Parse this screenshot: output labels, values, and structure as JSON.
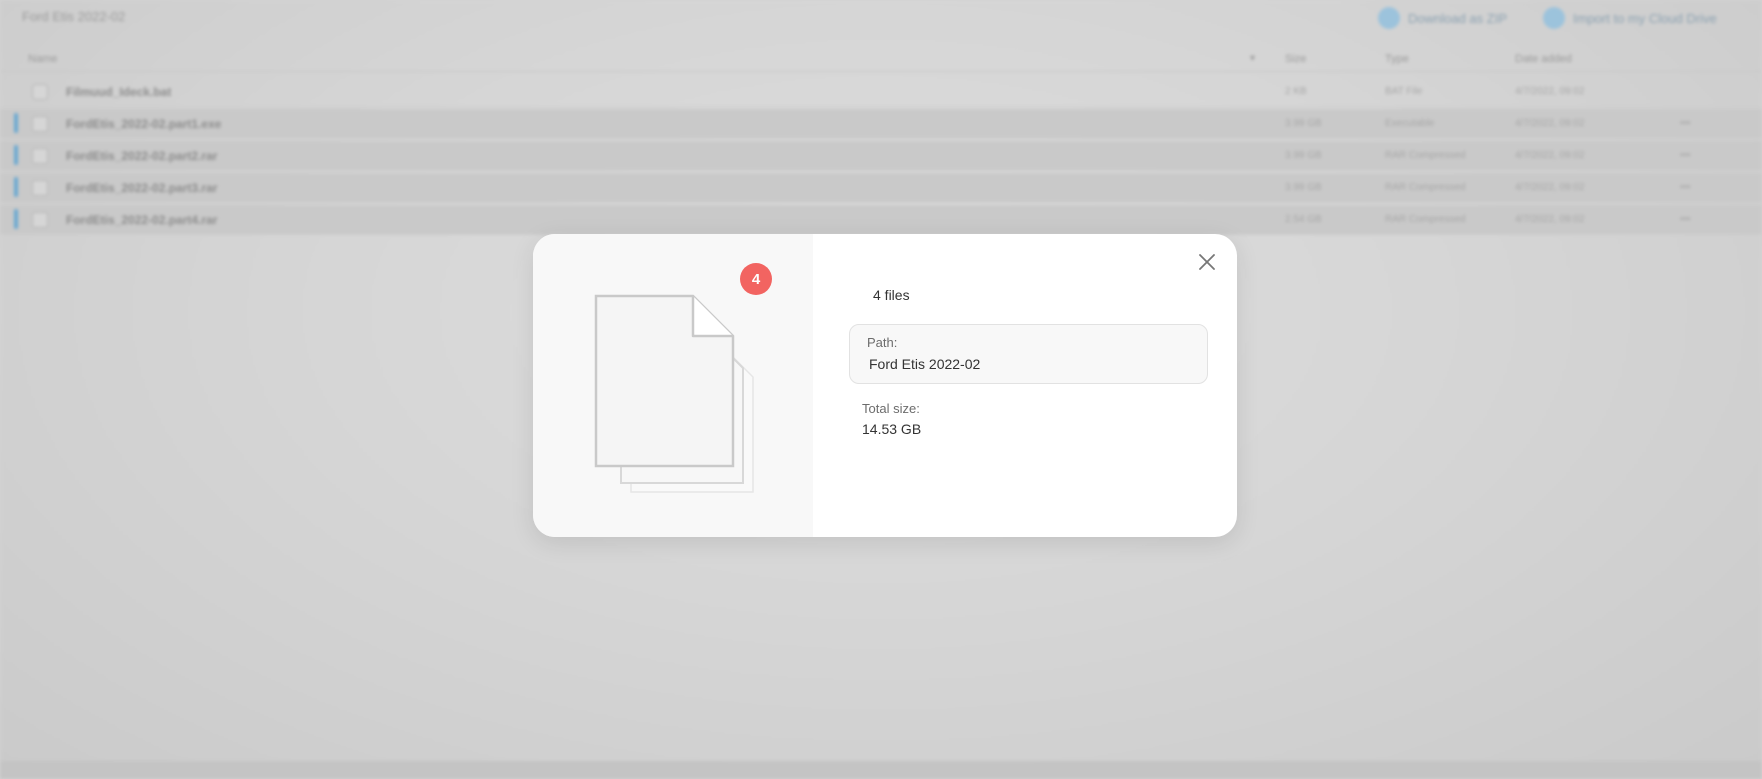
{
  "background": {
    "title": "Ford Etis 2022-02",
    "actions": [
      {
        "label": "Download as ZIP",
        "icon": "download-icon"
      },
      {
        "label": "Import to my Cloud Drive",
        "icon": "cloud-import-icon"
      }
    ],
    "columns": [
      "Name",
      "Size",
      "Type",
      "Date added"
    ],
    "rows": [
      {
        "name": "Filmuud_Ideck.bat",
        "size": "2 KB",
        "type": "BAT File",
        "date": "4/7/2022, 09:02"
      },
      {
        "name": "FordEtis_2022-02.part1.exe",
        "size": "3.99 GB",
        "type": "Executable",
        "date": "4/7/2022, 09:02"
      },
      {
        "name": "FordEtis_2022-02.part2.rar",
        "size": "3.99 GB",
        "type": "RAR Compressed",
        "date": "4/7/2022, 09:02"
      },
      {
        "name": "FordEtis_2022-02.part3.rar",
        "size": "3.99 GB",
        "type": "RAR Compressed",
        "date": "4/7/2022, 09:02"
      },
      {
        "name": "FordEtis_2022-02.part4.rar",
        "size": "2.54 GB",
        "type": "RAR Compressed",
        "date": "4/7/2022, 09:02"
      }
    ]
  },
  "modal": {
    "badge_count": "4",
    "files_count": "4 files",
    "path_label": "Path:",
    "path_value": "Ford Etis 2022-02",
    "size_label": "Total size:",
    "size_value": "14.53 GB",
    "close_icon": "close-icon",
    "badge_color": "#f26461"
  }
}
